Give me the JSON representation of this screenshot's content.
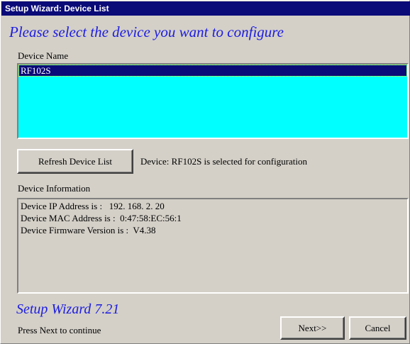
{
  "window": {
    "title": "Setup Wizard: Device List"
  },
  "headline": "Please select the device you want to configure",
  "device_list": {
    "label": "Device Name",
    "items": [
      "RF102S"
    ],
    "selected_index": 0
  },
  "refresh_button": "Refresh Device List",
  "status_text": "Device: RF102S is selected for configuration",
  "device_info": {
    "label": "Device Information",
    "lines": [
      "Device IP Address is :   192. 168. 2. 20",
      "Device MAC Address is :  0:47:58:EC:56:1",
      "Device Firmware Version is :  V4.38"
    ]
  },
  "footer": {
    "wizard_version": "Setup Wizard 7.21",
    "hint": "Press Next to continue",
    "next_label": "Next>>",
    "cancel_label": "Cancel"
  },
  "colors": {
    "titlebar": "#0a0a78",
    "accent_text": "#1c1ce0",
    "listbox_bg": "#00ffff",
    "window_bg": "#d4d0c8"
  }
}
